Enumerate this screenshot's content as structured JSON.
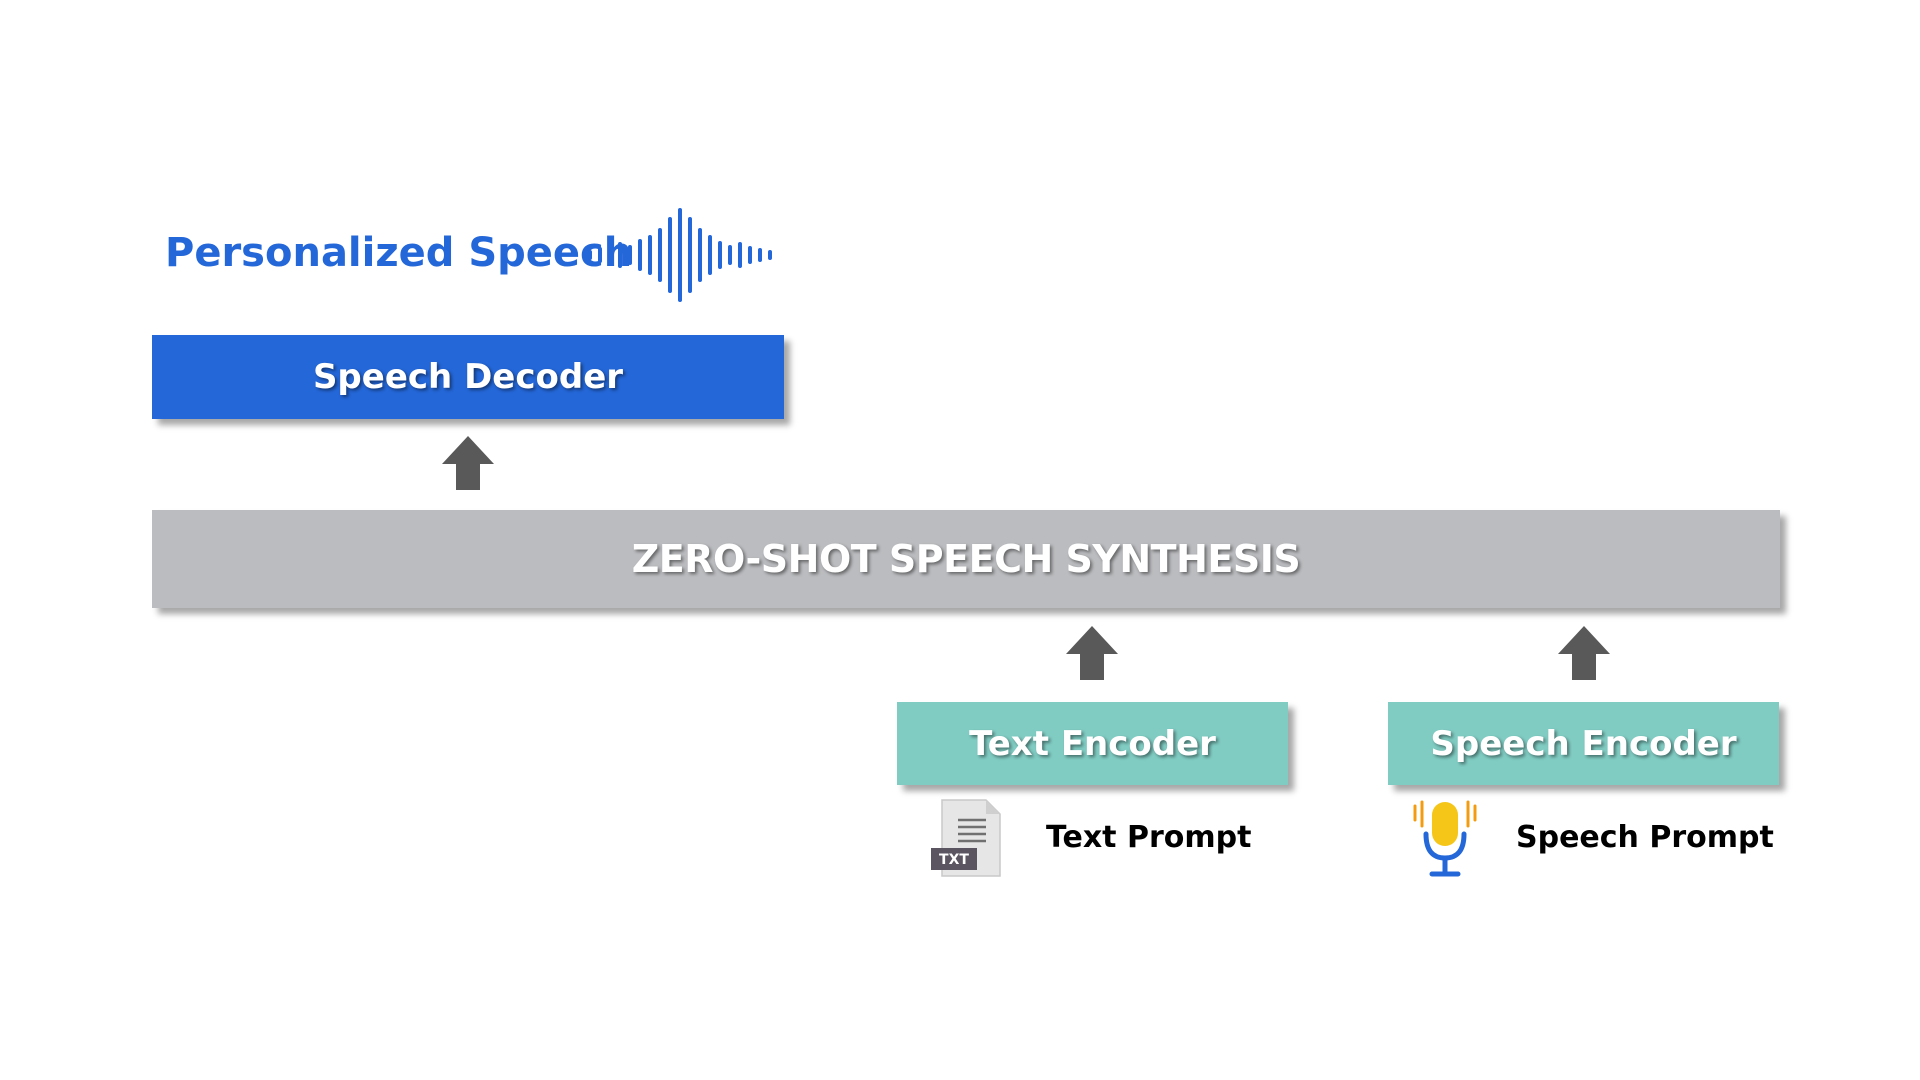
{
  "diagram": {
    "output_title": "Personalized Speech",
    "decoder_label": "Speech Decoder",
    "synthesis_label": "ZERO-SHOT SPEECH SYNTHESIS",
    "text_encoder_label": "Text Encoder",
    "speech_encoder_label": "Speech Encoder",
    "text_prompt_label": "Text Prompt",
    "speech_prompt_label": "Speech Prompt",
    "txt_badge": "TXT"
  },
  "icons": {
    "waveform": "waveform-icon",
    "text_file": "txt-file-icon",
    "microphone": "microphone-icon",
    "arrow": "arrow-up-icon"
  },
  "colors": {
    "decoder_blue": "#2467d8",
    "synthesis_gray": "#bbbcbf",
    "encoder_teal": "#80ccc3",
    "arrow_gray": "#595959",
    "mic_yellow": "#f5c518",
    "mic_orange": "#f39c12"
  }
}
